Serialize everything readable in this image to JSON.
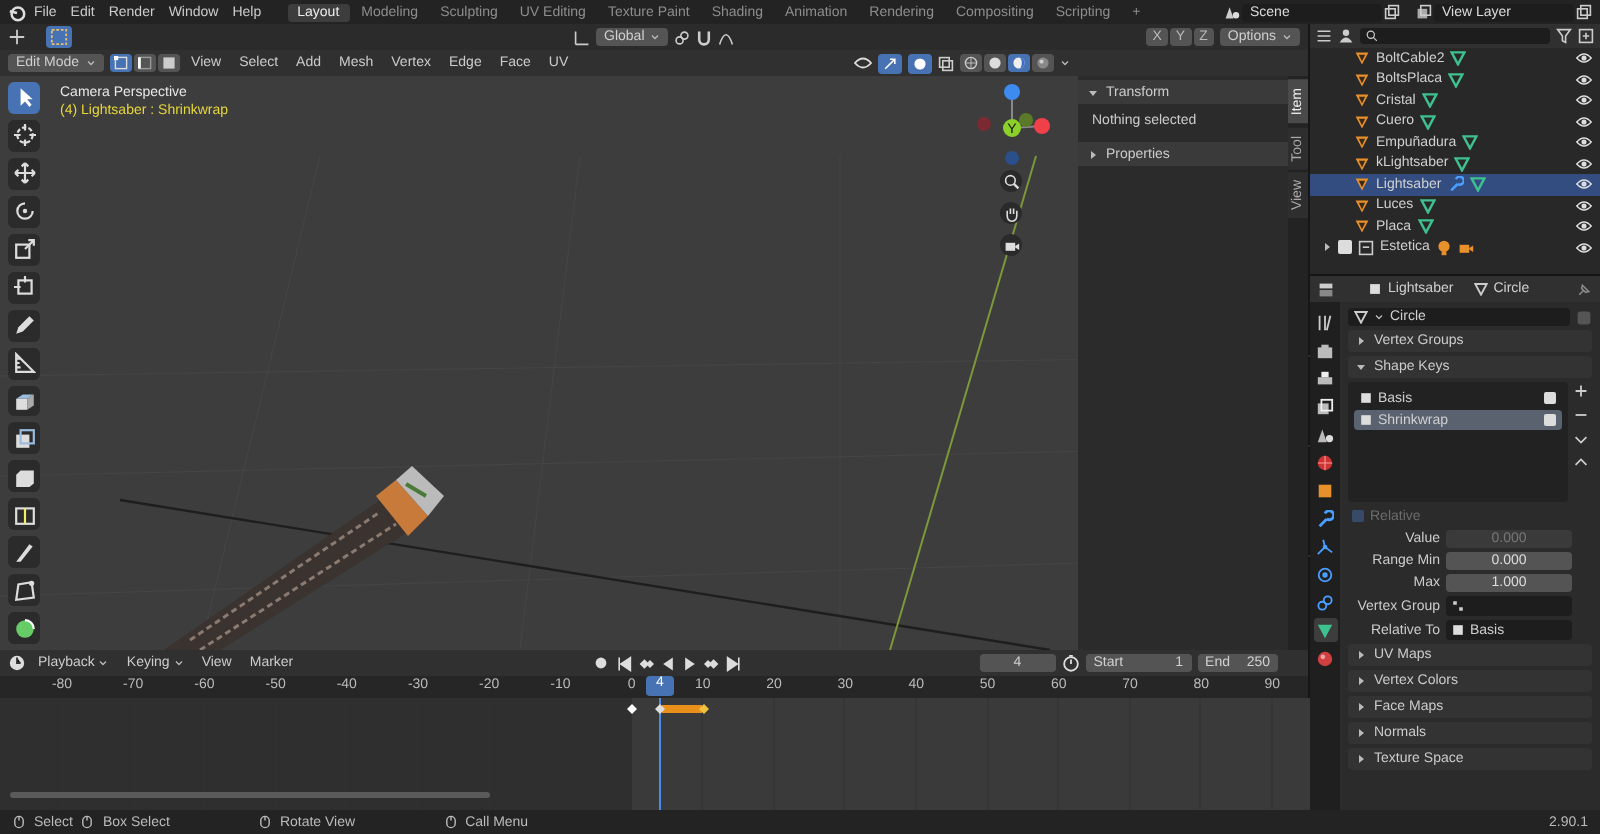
{
  "top_bar": {
    "menus": [
      "File",
      "Edit",
      "Render",
      "Window",
      "Help"
    ],
    "workspaces": [
      {
        "label": "Layout",
        "selected": true
      },
      {
        "label": "Modeling",
        "selected": false
      },
      {
        "label": "Sculpting",
        "selected": false
      },
      {
        "label": "UV Editing",
        "selected": false
      },
      {
        "label": "Texture Paint",
        "selected": false
      },
      {
        "label": "Shading",
        "selected": false
      },
      {
        "label": "Animation",
        "selected": false
      },
      {
        "label": "Rendering",
        "selected": false
      },
      {
        "label": "Compositing",
        "selected": false
      },
      {
        "label": "Scripting",
        "selected": false
      }
    ],
    "add_tab": "+",
    "scene": "Scene",
    "view_layer": "View Layer"
  },
  "viewport": {
    "tool_header": {
      "orientation": "Global",
      "mirror_axes": [
        "X",
        "Y",
        "Z"
      ],
      "options": "Options"
    },
    "header": {
      "mode": "Edit Mode",
      "select_modes": [
        {
          "kind": "vertex",
          "selected": true
        },
        {
          "kind": "edge",
          "selected": false
        },
        {
          "kind": "face",
          "selected": false
        }
      ],
      "menus": [
        "View",
        "Select",
        "Add",
        "Mesh",
        "Vertex",
        "Edge",
        "Face",
        "UV"
      ],
      "shading_modes": [
        {
          "kind": "wireframe",
          "selected": false
        },
        {
          "kind": "solid",
          "selected": false
        },
        {
          "kind": "material",
          "selected": true
        },
        {
          "kind": "rendered",
          "selected": false
        }
      ]
    },
    "tools": [
      {
        "kind": "select",
        "selected": true
      },
      {
        "kind": "cursor",
        "selected": false
      },
      {
        "kind": "move",
        "selected": false
      },
      {
        "kind": "rotate",
        "selected": false
      },
      {
        "kind": "scale",
        "selected": false
      },
      {
        "kind": "transform",
        "selected": false
      },
      {
        "kind": "annotate",
        "selected": false
      },
      {
        "kind": "measure",
        "selected": false
      },
      {
        "kind": "extrude",
        "selected": false
      },
      {
        "kind": "inset",
        "selected": false
      },
      {
        "kind": "bevel",
        "selected": false
      },
      {
        "kind": "loop_cut",
        "selected": false
      },
      {
        "kind": "knife",
        "selected": false
      },
      {
        "kind": "poly_build",
        "selected": false
      },
      {
        "kind": "spin",
        "selected": false
      }
    ],
    "overlay": {
      "view_name": "Camera Perspective",
      "object_info": "(4) Lightsaber : Shrinkwrap"
    },
    "gizmo_label": "Y",
    "sidebar": {
      "tabs": [
        {
          "label": "Item",
          "selected": true
        },
        {
          "label": "Tool",
          "selected": false
        },
        {
          "label": "View",
          "selected": false
        }
      ],
      "panels": [
        {
          "title": "Transform",
          "expanded": true,
          "body": "Nothing selected"
        },
        {
          "title": "Properties",
          "expanded": false
        }
      ]
    }
  },
  "timeline": {
    "menus": [
      "Playback",
      "Keying",
      "View",
      "Marker"
    ],
    "current_frame": "4",
    "start_label": "Start",
    "start": "1",
    "end_label": "End",
    "end": "250",
    "ruler": [
      "-80",
      "-70",
      "-60",
      "-50",
      "-40",
      "-30",
      "-20",
      "-10",
      "0",
      "10",
      "20",
      "30",
      "40",
      "50",
      "60",
      "70",
      "80",
      "90"
    ],
    "playhead": "4"
  },
  "outliner": {
    "items": [
      {
        "name": "BoltCable2",
        "selected": false,
        "has_modifier": false
      },
      {
        "name": "BoltsPlaca",
        "selected": false,
        "has_modifier": false
      },
      {
        "name": "Cristal",
        "selected": false,
        "has_modifier": false
      },
      {
        "name": "Cuero",
        "selected": false,
        "has_modifier": false
      },
      {
        "name": "Empuñadura",
        "selected": false,
        "has_modifier": false
      },
      {
        "name": "kLightsaber",
        "selected": false,
        "has_modifier": false
      },
      {
        "name": "Lightsaber",
        "selected": true,
        "has_modifier": true
      },
      {
        "name": "Luces",
        "selected": false,
        "has_modifier": false
      },
      {
        "name": "Placa",
        "selected": false,
        "has_modifier": false
      }
    ],
    "collection": {
      "name": "Estetica",
      "checked": true
    }
  },
  "properties": {
    "object": "Lightsaber",
    "data": "Circle",
    "mesh": "Circle",
    "tabs": [
      {
        "kind": "tool",
        "selected": false
      },
      {
        "kind": "render",
        "selected": false
      },
      {
        "kind": "output",
        "selected": false
      },
      {
        "kind": "view_layer",
        "selected": false
      },
      {
        "kind": "scene",
        "selected": false
      },
      {
        "kind": "world",
        "selected": false
      },
      {
        "kind": "object",
        "selected": false
      },
      {
        "kind": "modifier",
        "selected": false
      },
      {
        "kind": "particles",
        "selected": false
      },
      {
        "kind": "physics",
        "selected": false
      },
      {
        "kind": "constraints",
        "selected": false
      },
      {
        "kind": "data",
        "selected": true
      },
      {
        "kind": "material",
        "selected": false
      }
    ],
    "panels": [
      {
        "title": "Vertex Groups",
        "expanded": false
      },
      {
        "title": "Shape Keys",
        "expanded": true
      }
    ],
    "shape_keys": [
      {
        "name": "Basis",
        "selected": false,
        "enabled": true
      },
      {
        "name": "Shrinkwrap",
        "selected": true,
        "enabled": true
      }
    ],
    "relative": {
      "label": "Relative",
      "checked": true,
      "disabled": true
    },
    "fields": [
      {
        "label": "Value",
        "value": "0.000",
        "disabled": true
      },
      {
        "label": "Range Min",
        "value": "0.000",
        "disabled": false
      },
      {
        "label": "Max",
        "value": "1.000",
        "disabled": false
      }
    ],
    "vertex_group": {
      "label": "Vertex Group"
    },
    "relative_to": {
      "label": "Relative To",
      "value": "Basis"
    },
    "more_panels": [
      {
        "title": "UV Maps",
        "expanded": false
      },
      {
        "title": "Vertex Colors",
        "expanded": false
      },
      {
        "title": "Face Maps",
        "expanded": false
      },
      {
        "title": "Normals",
        "expanded": false
      },
      {
        "title": "Texture Space",
        "expanded": false
      }
    ]
  },
  "status_bar": {
    "hints": [
      "Select",
      "Box Select",
      "Rotate View",
      "Call Menu"
    ],
    "version": "2.90.1"
  }
}
